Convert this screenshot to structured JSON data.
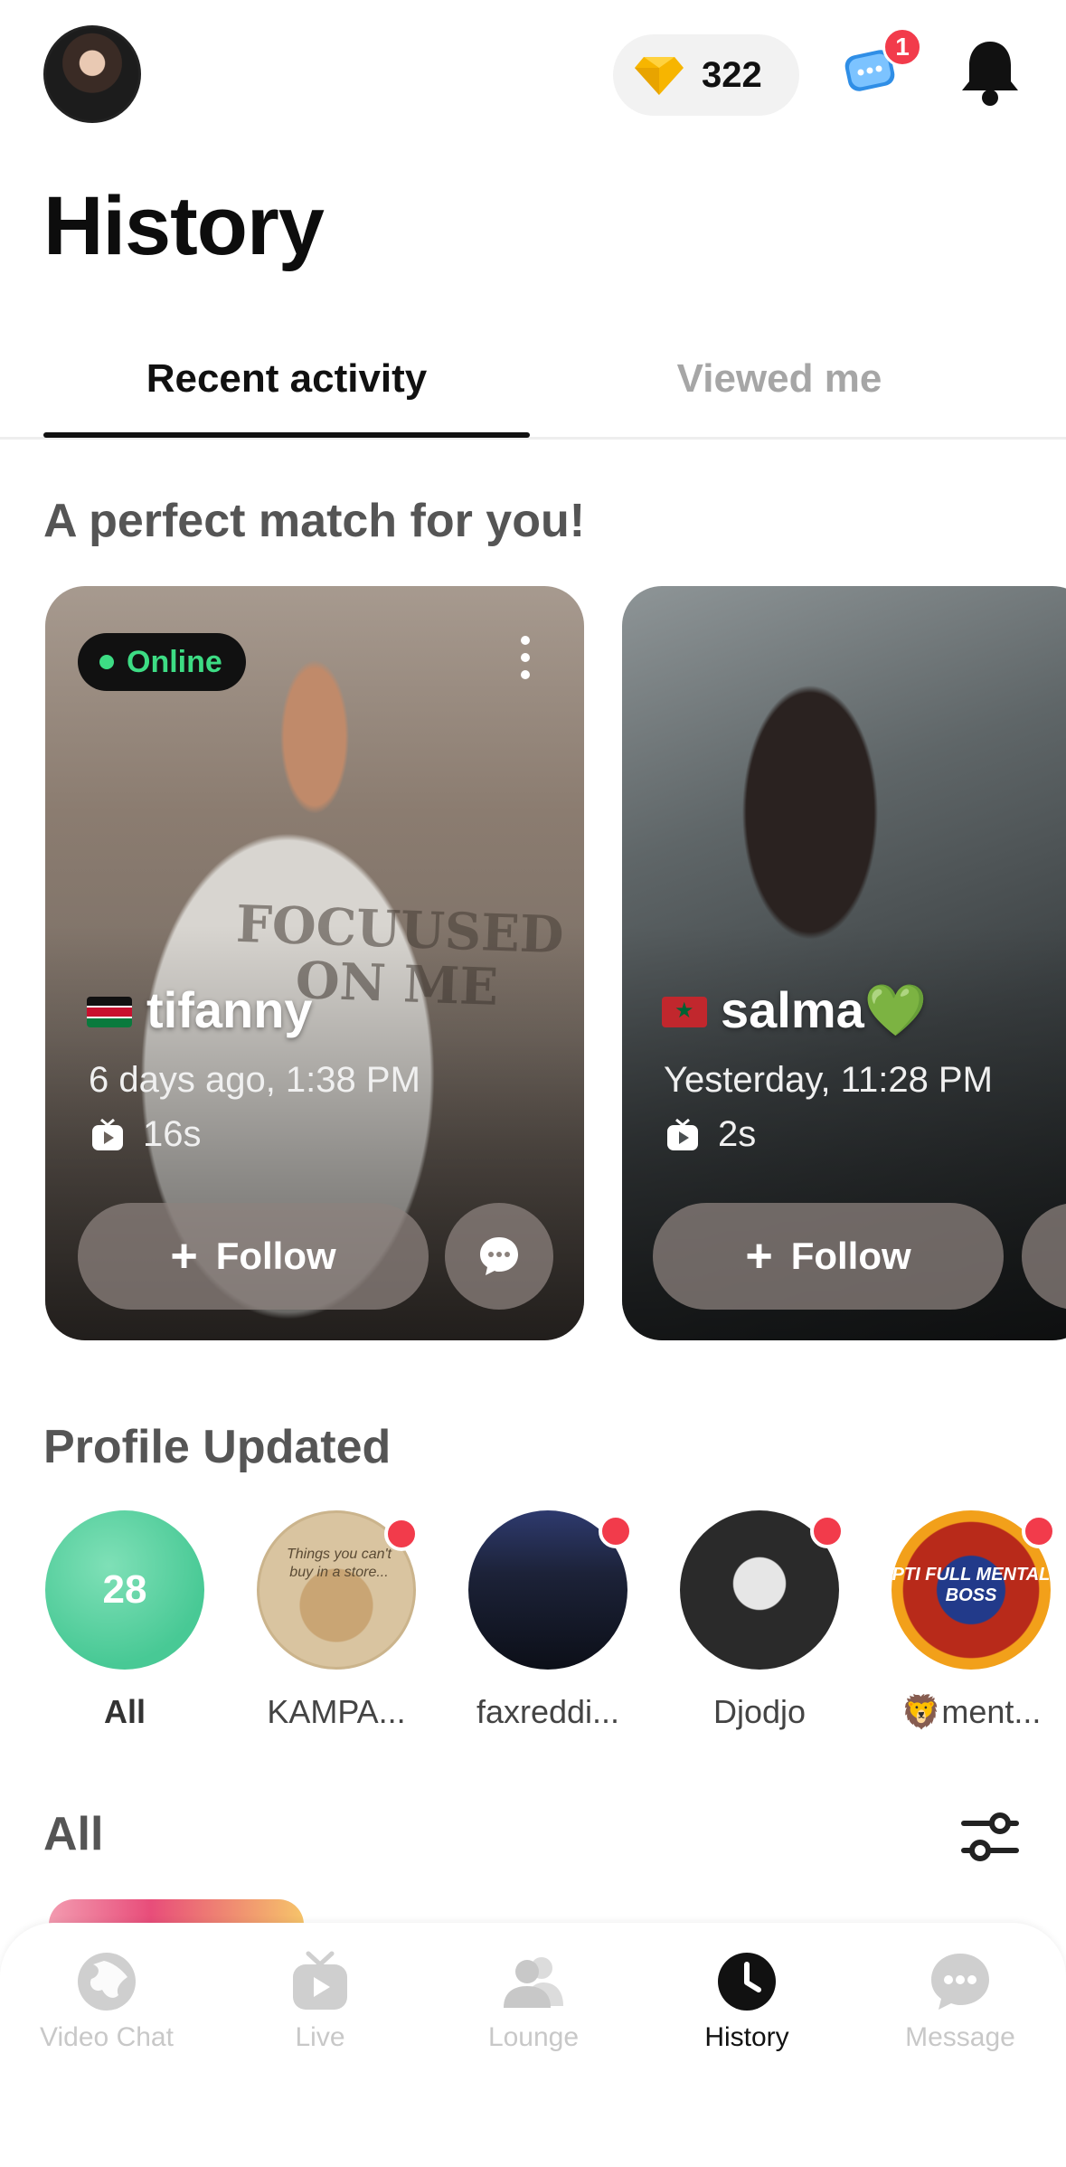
{
  "header": {
    "coins": "322",
    "chat_badge": "1"
  },
  "page": {
    "title": "History"
  },
  "tabs": [
    {
      "label": "Recent activity",
      "active": true
    },
    {
      "label": "Viewed me",
      "active": false
    }
  ],
  "match_section": {
    "title": "A perfect match for you!",
    "cards": [
      {
        "status": "Online",
        "name": "tifanny",
        "emoji": "",
        "country_flag": "kenya-flag",
        "time": "6 days ago, 1:38 PM",
        "duration": "16s",
        "follow_label": "Follow",
        "sweater_text": "FOCUUSED ON ME"
      },
      {
        "name": "salma",
        "emoji": "💚",
        "country_flag": "morocco-flag",
        "time": "Yesterday, 11:28 PM",
        "duration": "2s",
        "follow_label": "Follow"
      }
    ]
  },
  "profile_updated": {
    "title": "Profile Updated",
    "all_count": "28",
    "all_label": "All",
    "items": [
      {
        "label": "KAMPA...",
        "avatar_text": "Things you can't buy in a store..."
      },
      {
        "label": "faxreddi..."
      },
      {
        "label": "Djodjo"
      },
      {
        "label": "🦁ment...",
        "avatar_text": "PTI FULL MENTAL BOSS"
      }
    ]
  },
  "all_section": {
    "title": "All"
  },
  "bottom_nav": [
    {
      "label": "Video Chat",
      "icon": "globe-icon",
      "active": false
    },
    {
      "label": "Live",
      "icon": "tv-icon",
      "active": false
    },
    {
      "label": "Lounge",
      "icon": "people-icon",
      "active": false
    },
    {
      "label": "History",
      "icon": "clock-icon",
      "active": true
    },
    {
      "label": "Message",
      "icon": "chat-bubble-icon",
      "active": false
    }
  ],
  "colors": {
    "online_green": "#3ddc84",
    "badge_red": "#f23b4b",
    "all_avatar_green": "#48c995"
  }
}
